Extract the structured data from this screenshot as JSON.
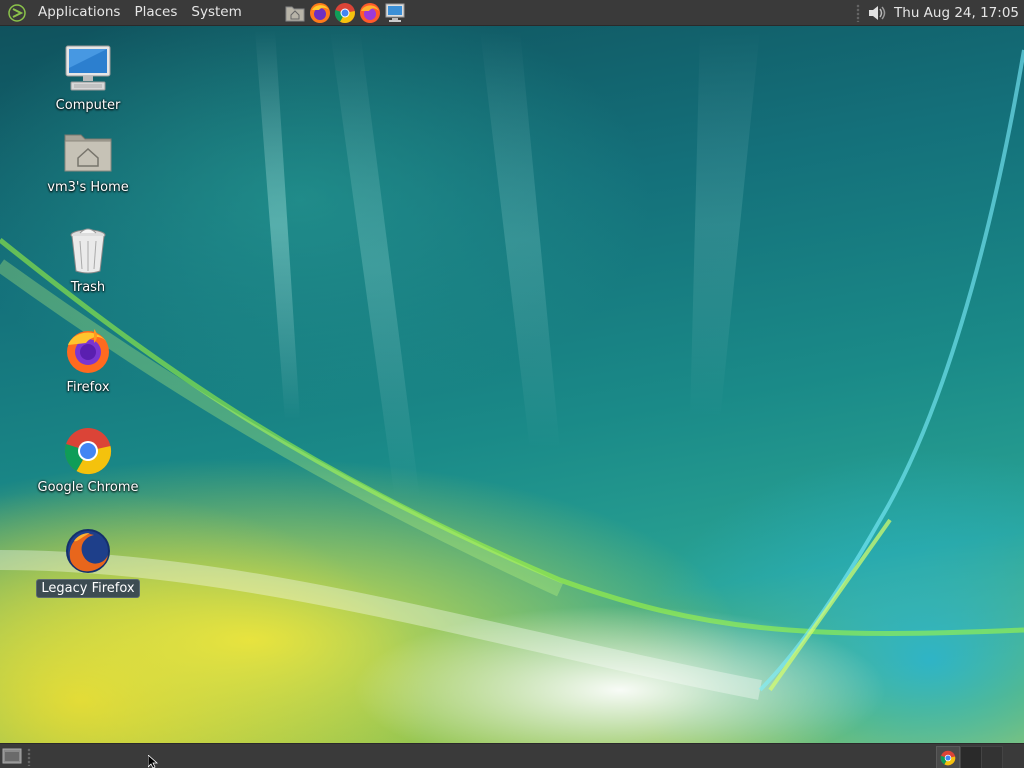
{
  "top_panel": {
    "menus": [
      "Applications",
      "Places",
      "System"
    ],
    "launchers": [
      "home-folder-launcher-icon",
      "firefox-launcher-icon",
      "chrome-launcher-icon",
      "firefox-launcher-icon",
      "computer-launcher-icon"
    ],
    "clock": "Thu Aug 24, 17:05"
  },
  "desktop": {
    "icons": [
      {
        "label": "Computer",
        "icon": "computer-icon"
      },
      {
        "label": "vm3's Home",
        "icon": "home-folder-icon"
      },
      {
        "label": "Trash",
        "icon": "trash-icon"
      },
      {
        "label": "Firefox",
        "icon": "firefox-icon"
      },
      {
        "label": "Google Chrome",
        "icon": "chrome-icon"
      },
      {
        "label": "Legacy Firefox",
        "icon": "legacy-firefox-icon",
        "selected": true
      }
    ]
  },
  "bottom_panel": {
    "tasks": [
      {
        "app": "Google Chrome",
        "icon": "chrome-icon"
      }
    ],
    "workspaces": 2
  },
  "colors": {
    "panel": "#3a3a3a",
    "accent": "#3d4c52"
  }
}
